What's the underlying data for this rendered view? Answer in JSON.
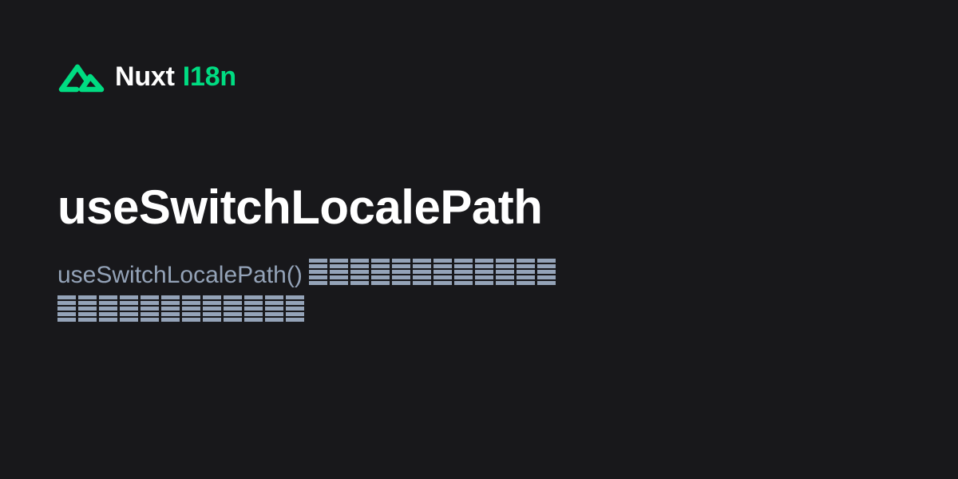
{
  "brand": {
    "name": "Nuxt",
    "module": "I18n",
    "accent_color": "#00dc82",
    "logo_icon": "nuxt-mountain-icon"
  },
  "page": {
    "title": "useSwitchLocalePath",
    "description_prefix": "useSwitchLocalePath()",
    "description_rest_line1": "████████████",
    "description_rest_line2": "████████████"
  },
  "colors": {
    "background": "#18181b",
    "title": "#ffffff",
    "description": "#94a3b8"
  }
}
